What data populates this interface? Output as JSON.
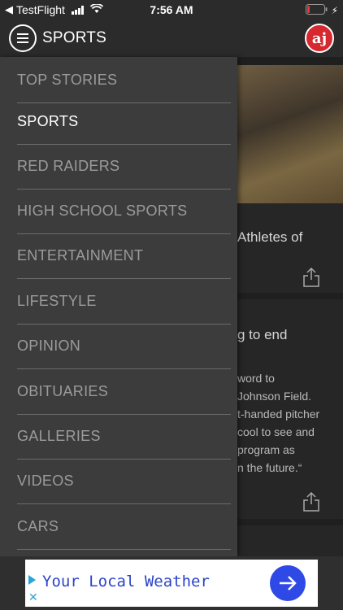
{
  "status_bar": {
    "carrier": "TestFlight",
    "time": "7:56 AM"
  },
  "header": {
    "title": "SPORTS",
    "logo_text": "aj"
  },
  "drawer": {
    "items": [
      {
        "label": "TOP STORIES",
        "active": false
      },
      {
        "label": "SPORTS",
        "active": true
      },
      {
        "label": "RED RAIDERS",
        "active": false
      },
      {
        "label": "HIGH SCHOOL SPORTS",
        "active": false
      },
      {
        "label": "ENTERTAINMENT",
        "active": false
      },
      {
        "label": "LIFESTYLE",
        "active": false
      },
      {
        "label": "OPINION",
        "active": false
      },
      {
        "label": "OBITUARIES",
        "active": false
      },
      {
        "label": "GALLERIES",
        "active": false
      },
      {
        "label": "VIDEOS",
        "active": false
      },
      {
        "label": "CARS",
        "active": false
      }
    ]
  },
  "background": {
    "card1_title": "Athletes of",
    "card2_title": "g to end",
    "card2_body": [
      "word to",
      "Johnson Field.",
      "t-handed pitcher",
      "cool to see and",
      "program as",
      "n the future.“"
    ]
  },
  "ad": {
    "text": "Your Local Weather"
  },
  "colors": {
    "drawer_bg": "#3c3c3c",
    "header_bg": "#2b2b2b",
    "logo_red": "#d7282f",
    "ad_blue": "#2e49e6"
  }
}
